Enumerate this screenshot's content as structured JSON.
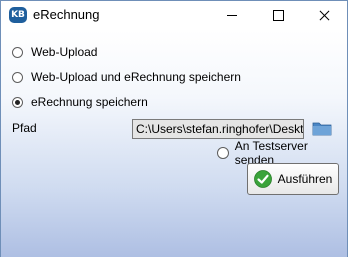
{
  "window": {
    "icon_text": "KB",
    "title": "eRechnung"
  },
  "options": [
    {
      "label": "Web-Upload",
      "selected": false
    },
    {
      "label": "Web-Upload und eRechnung speichern",
      "selected": false
    },
    {
      "label": "eRechnung speichern",
      "selected": true
    }
  ],
  "path": {
    "label": "Pfad",
    "value": "C:\\Users\\stefan.ringhofer\\Desktop"
  },
  "test_server": {
    "label": "An Testserver senden",
    "checked": false
  },
  "execute": {
    "label": "Ausführen"
  },
  "colors": {
    "icon_bg": "#1f5f9d",
    "folder": "#4a86c5",
    "ok_green": "#3aa33a"
  }
}
